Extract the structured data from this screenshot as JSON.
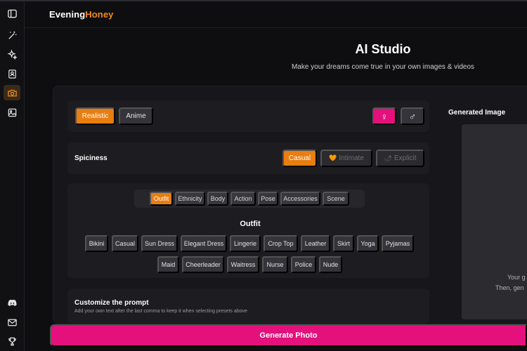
{
  "brand": {
    "part1": "Evening",
    "part2": "Honey"
  },
  "header": {
    "title": "AI Studio",
    "subtitle": "Make your dreams come true in your own images & videos"
  },
  "style_toggle": {
    "realistic": "Realistic",
    "anime": "Anime",
    "selected": "Realistic"
  },
  "gender": {
    "female_icon": "♀",
    "male_icon": "♂",
    "selected": "female"
  },
  "spiciness": {
    "label": "Spiciness",
    "casual": "Casual",
    "intimate": "Intimate",
    "explicit": "Explicit",
    "selected": "Casual"
  },
  "tabs": {
    "items": [
      "Outfit",
      "Ethnicity",
      "Body",
      "Action",
      "Pose",
      "Accessories",
      "Scene"
    ],
    "selected": "Outfit"
  },
  "outfit": {
    "title": "Outfit",
    "options": [
      "Bikini",
      "Casual",
      "Sun Dress",
      "Elegant Dress",
      "Lingerie",
      "Crop Top",
      "Leather",
      "Skirt",
      "Yoga",
      "Pyjamas",
      "Maid",
      "Cheerleader",
      "Waitress",
      "Nurse",
      "Police",
      "Nude"
    ]
  },
  "customize": {
    "title": "Customize the prompt",
    "description": "Add your own text after the last comma to keep it when selecting presets above"
  },
  "generated": {
    "label": "Generated Image",
    "hint_line1": "Your g",
    "hint_line2": "Then, gen"
  },
  "generate_button": "Generate Photo",
  "colors": {
    "accent": "#e87d10",
    "pink": "#e4117c",
    "background": "#0e0e11"
  },
  "sidebar_icons": [
    "sidebar-toggle-icon",
    "magic-wand-icon",
    "sparkles-icon",
    "portrait-card-icon",
    "camera-icon",
    "image-icon",
    "discord-icon",
    "mail-icon",
    "trophy-icon"
  ]
}
